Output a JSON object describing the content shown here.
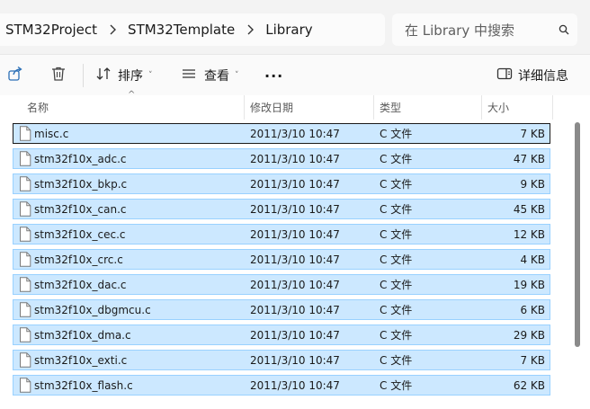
{
  "breadcrumb": [
    "STM32Project",
    "STM32Template",
    "Library"
  ],
  "search": {
    "placeholder": "在 Library 中搜索"
  },
  "toolbar": {
    "sort_label": "排序",
    "view_label": "查看",
    "more_label": "···",
    "details_label": "详细信息"
  },
  "columns": {
    "name": "名称",
    "date": "修改日期",
    "type": "类型",
    "size": "大小"
  },
  "files": [
    {
      "name": "misc.c",
      "date": "2011/3/10 10:47",
      "type": "C 文件",
      "size": "7 KB"
    },
    {
      "name": "stm32f10x_adc.c",
      "date": "2011/3/10 10:47",
      "type": "C 文件",
      "size": "47 KB"
    },
    {
      "name": "stm32f10x_bkp.c",
      "date": "2011/3/10 10:47",
      "type": "C 文件",
      "size": "9 KB"
    },
    {
      "name": "stm32f10x_can.c",
      "date": "2011/3/10 10:47",
      "type": "C 文件",
      "size": "45 KB"
    },
    {
      "name": "stm32f10x_cec.c",
      "date": "2011/3/10 10:47",
      "type": "C 文件",
      "size": "12 KB"
    },
    {
      "name": "stm32f10x_crc.c",
      "date": "2011/3/10 10:47",
      "type": "C 文件",
      "size": "4 KB"
    },
    {
      "name": "stm32f10x_dac.c",
      "date": "2011/3/10 10:47",
      "type": "C 文件",
      "size": "19 KB"
    },
    {
      "name": "stm32f10x_dbgmcu.c",
      "date": "2011/3/10 10:47",
      "type": "C 文件",
      "size": "6 KB"
    },
    {
      "name": "stm32f10x_dma.c",
      "date": "2011/3/10 10:47",
      "type": "C 文件",
      "size": "29 KB"
    },
    {
      "name": "stm32f10x_exti.c",
      "date": "2011/3/10 10:47",
      "type": "C 文件",
      "size": "7 KB"
    },
    {
      "name": "stm32f10x_flash.c",
      "date": "2011/3/10 10:47",
      "type": "C 文件",
      "size": "62 KB"
    }
  ],
  "colors": {
    "selection_bg": "#cce8ff",
    "selection_border": "#99d1ff",
    "focus_border": "#1a1a1a"
  },
  "icons": [
    "share-icon",
    "delete-icon",
    "sort-icon",
    "view-icon",
    "more-icon",
    "details-pane-icon",
    "search-icon",
    "chevron-right-icon",
    "file-icon"
  ]
}
